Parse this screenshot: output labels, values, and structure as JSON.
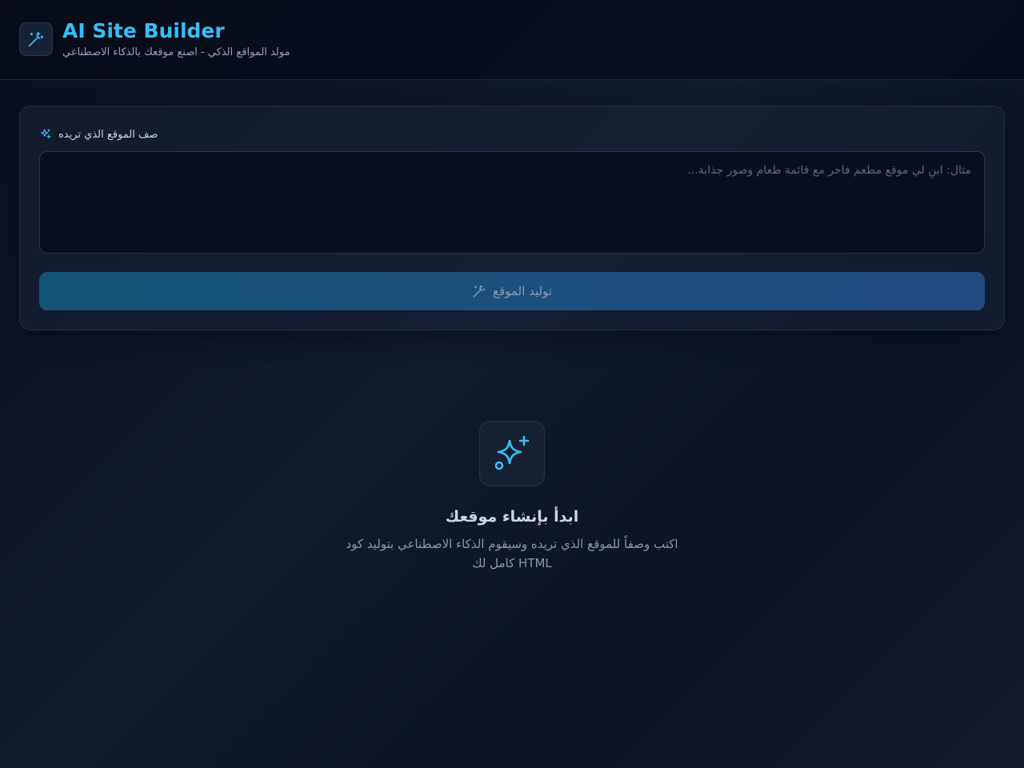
{
  "header": {
    "title": "AI Site Builder",
    "subtitle": "مولد المواقع الذكي - اصنع موقعك بالذكاء الاصطناعي",
    "logo_icon": "magic-wand-icon"
  },
  "form": {
    "label": "صف الموقع الذي تريده",
    "label_icon": "sparkles-icon",
    "prompt_placeholder": "مثال: ابنِ لي موقع مطعم فاخر مع قائمة طعام وصور جذابة...",
    "prompt_value": "",
    "generate_label": "توليد الموقع",
    "generate_icon": "magic-wand-icon"
  },
  "empty_state": {
    "icon": "sparkles-icon",
    "title": "ابدأ بإنشاء موقعك",
    "description": "اكتب وصفاً للموقع الذي تريده وسيقوم الذكاء الاصطناعي بتوليد كود HTML كامل لك"
  },
  "colors": {
    "accent": "#38bdf8",
    "background": "#0d1322",
    "button": "#1d4f7c"
  }
}
